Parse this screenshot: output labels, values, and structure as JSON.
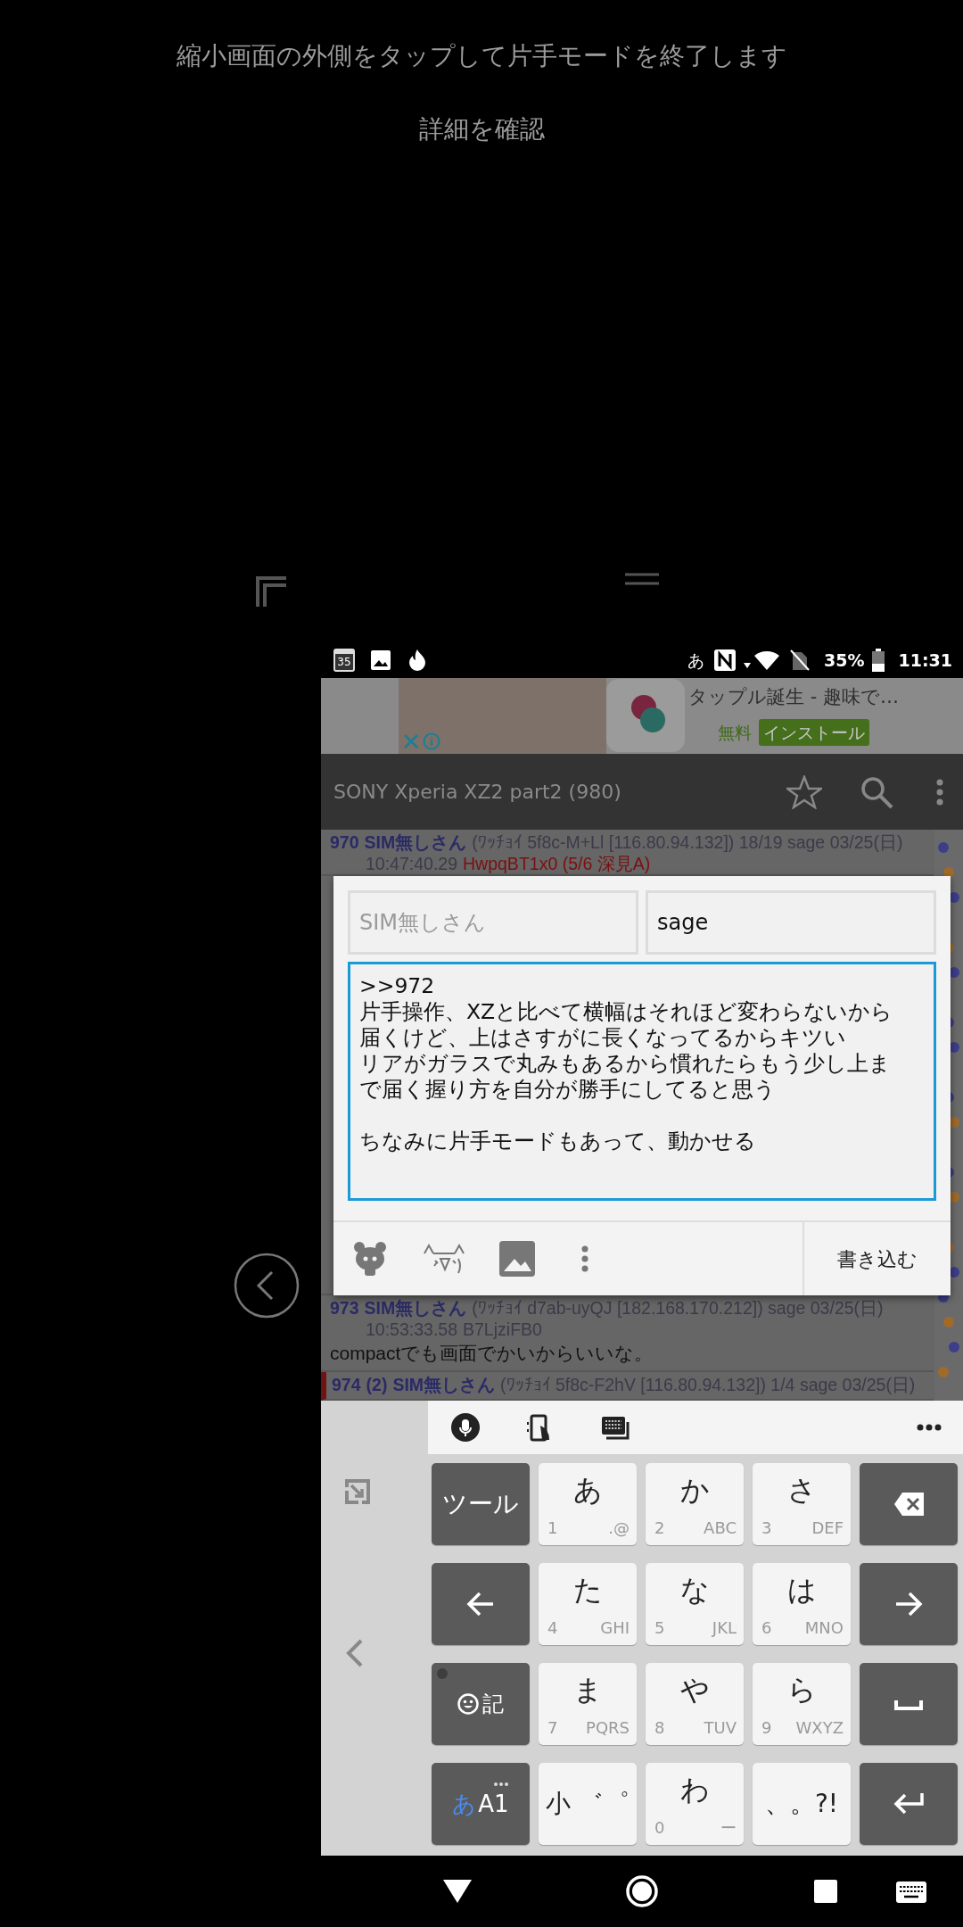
{
  "one_hand_hint": {
    "message": "縮小画面の外側をタップして片手モードを終了します",
    "details_link": "詳細を確認"
  },
  "status_bar": {
    "calendar_date": "35",
    "ime_indicator": "あ",
    "battery": "35%",
    "time": "11:31"
  },
  "ad": {
    "title": "タップル誕生 - 趣味で…",
    "price": "無料",
    "install": "インストール"
  },
  "toolbar": {
    "title": "SONY Xperia XZ2 part2 (980)"
  },
  "posts": [
    {
      "number": "970",
      "name": "SIM無しさん",
      "meta": "(ﾜｯﾁｮｲ 5f8c-M+Ll [116.80.94.132]) 18/19 sage 03/25(日)",
      "time": "10:47:40.29",
      "id": "HwpqBT1x0 (5/6 深見A)",
      "id_highlighted": true,
      "marked": false
    },
    {
      "number": "973",
      "name": "SIM無しさん",
      "meta": "(ﾜｯﾁｮｲ d7ab-uyQJ [182.168.170.212]) sage 03/25(日)",
      "time": "10:53:33.58",
      "id": "B7LjziFB0",
      "id_highlighted": false,
      "body": "compactでも画面でかいからいいな。",
      "marked": false
    },
    {
      "number": "974",
      "replies": "(2)",
      "name": "SIM無しさん",
      "meta": "(ﾜｯﾁｮｲ 5f8c-F2hV [116.80.94.132]) 1/4 sage 03/25(日)",
      "marked": true
    }
  ],
  "post_dialog": {
    "name_field": {
      "placeholder": "SIM無しさん"
    },
    "mail_field": {
      "value": "sage"
    },
    "message_paragraphs": [
      [
        ">>972",
        "片手操作、XZと比べて横幅はそれほど変わらないから",
        "届くけど、上はさすがに長くなってるからキツい",
        "リアがガラスで丸みもあるから慣れたらもう少し上ま",
        "で届く握り方を自分が勝手にしてると思う"
      ],
      [
        "ちなみに片手モードもあって、動かせる"
      ]
    ],
    "submit": "書き込む"
  },
  "keyboard": {
    "toolbar": [
      {
        "kind": "mic"
      },
      {
        "kind": "phone"
      },
      {
        "kind": "keyboard"
      },
      {
        "kind": "more"
      }
    ],
    "keys": [
      {
        "kind": "tool",
        "label": "ツール"
      },
      {
        "kind": "kana",
        "main": "あ",
        "digit": "1",
        "letters": ".@"
      },
      {
        "kind": "kana",
        "main": "か",
        "digit": "2",
        "letters": "ABC"
      },
      {
        "kind": "kana",
        "main": "さ",
        "digit": "3",
        "letters": "DEF"
      },
      {
        "kind": "backspace"
      },
      {
        "kind": "left"
      },
      {
        "kind": "kana",
        "main": "た",
        "digit": "4",
        "letters": "GHI"
      },
      {
        "kind": "kana",
        "main": "な",
        "digit": "5",
        "letters": "JKL"
      },
      {
        "kind": "kana",
        "main": "は",
        "digit": "6",
        "letters": "MNO"
      },
      {
        "kind": "right"
      },
      {
        "kind": "emoji",
        "label": "記"
      },
      {
        "kind": "kana",
        "main": "ま",
        "digit": "7",
        "letters": "PQRS"
      },
      {
        "kind": "kana",
        "main": "や",
        "digit": "8",
        "letters": "TUV"
      },
      {
        "kind": "kana",
        "main": "ら",
        "digit": "9",
        "letters": "WXYZ"
      },
      {
        "kind": "space"
      },
      {
        "kind": "mode",
        "active": "あ",
        "rest": "A1"
      },
      {
        "kind": "plain",
        "label": "小 ゛゜"
      },
      {
        "kind": "kana",
        "main": "わ",
        "digit": "0",
        "letters": "ー"
      },
      {
        "kind": "plain",
        "label": "、。?!"
      },
      {
        "kind": "enter"
      }
    ]
  }
}
